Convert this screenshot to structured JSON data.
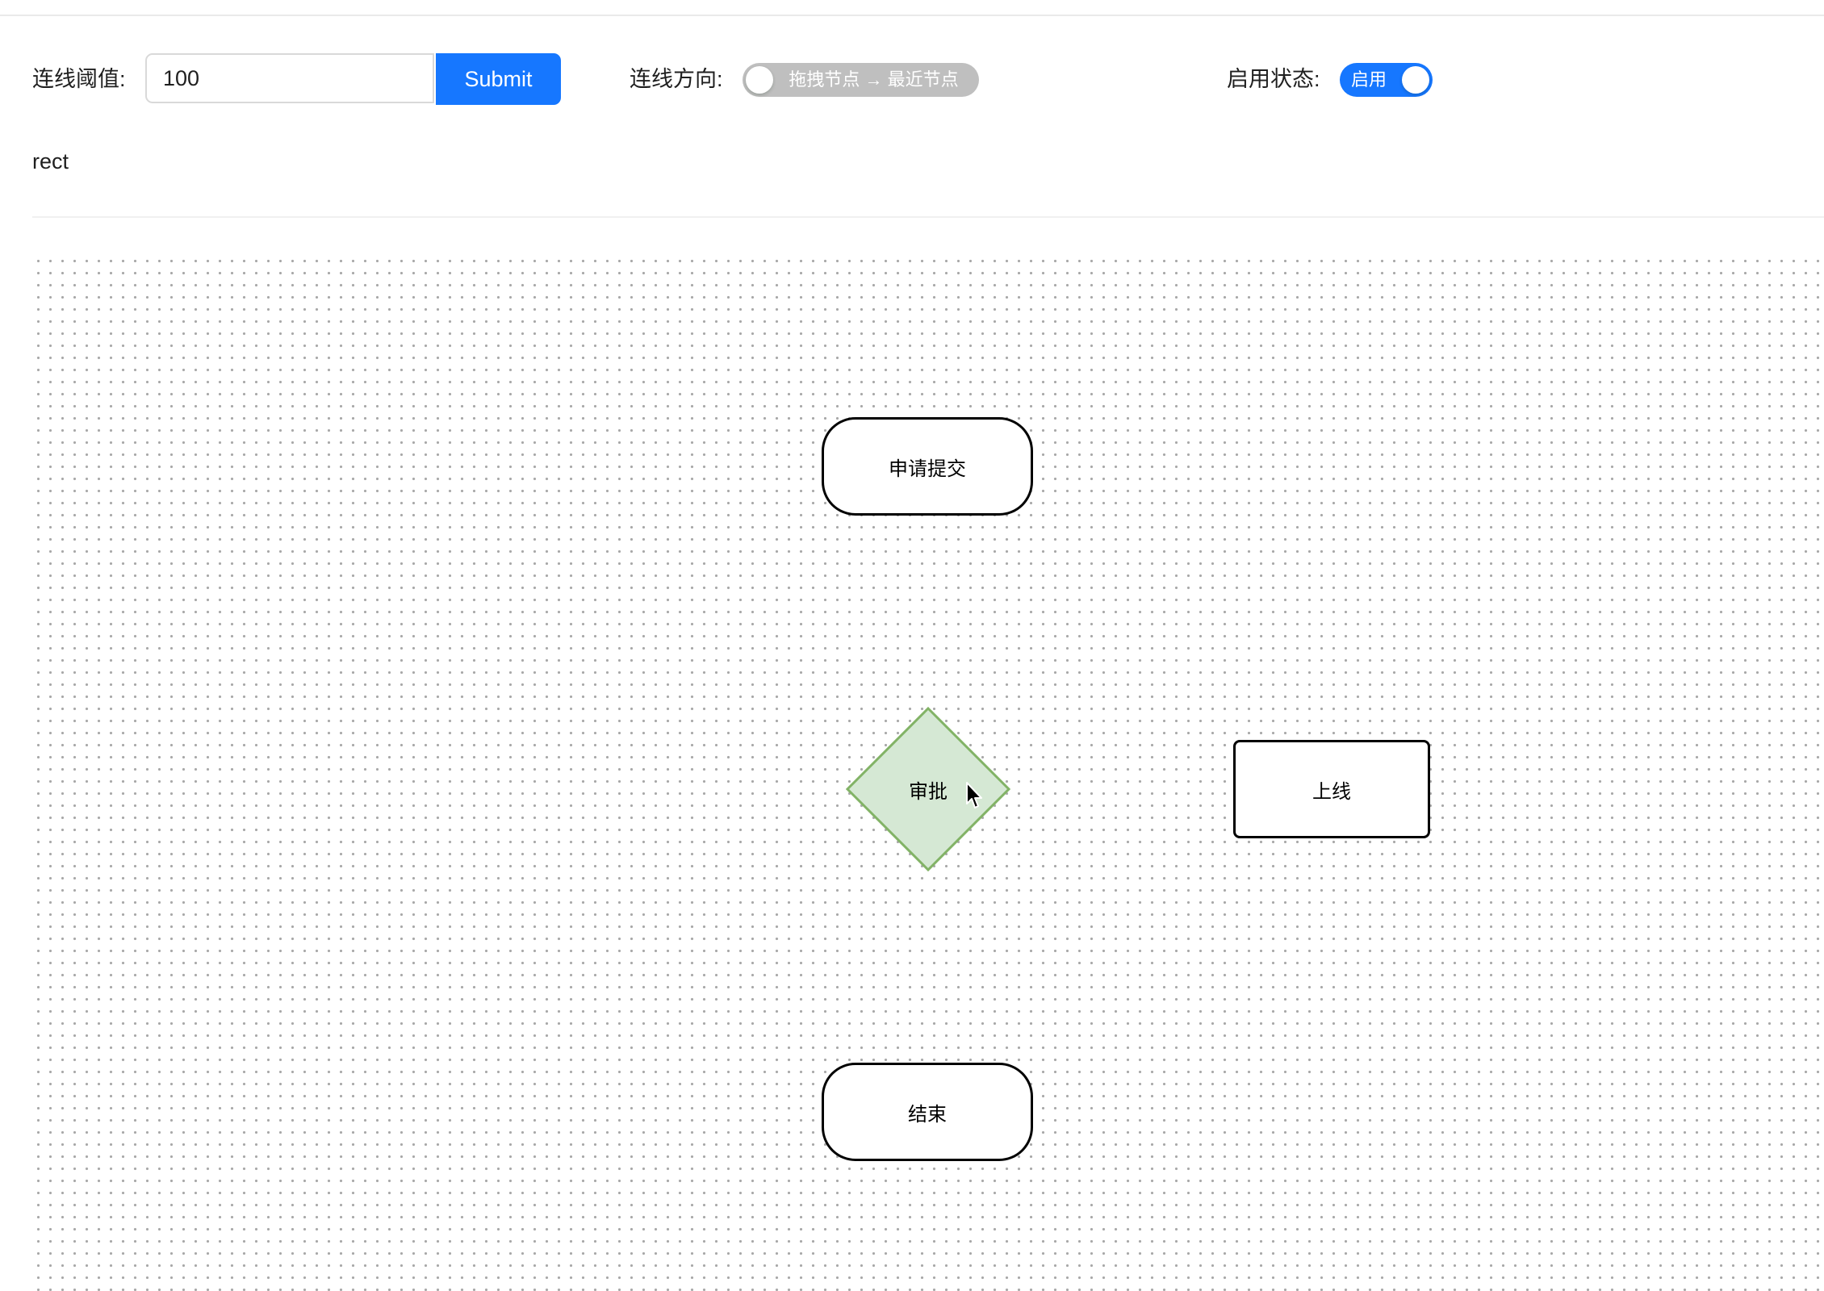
{
  "toolbar": {
    "threshold_label": "连线阈值:",
    "threshold_value": "100",
    "submit_label": "Submit",
    "direction_label": "连线方向:",
    "direction_switch_text": "拖拽节点 → 最近节点",
    "direction_switch_on": false,
    "enable_label": "启用状态:",
    "enable_switch_text": "启用",
    "enable_switch_on": true
  },
  "selected_shape": "rect",
  "canvas": {
    "grid": "dots",
    "nodes": {
      "start": {
        "label": "申请提交",
        "shape": "rounded-rect"
      },
      "approve": {
        "label": "审批",
        "shape": "diamond",
        "fill": "#d5e8d4",
        "stroke": "#82b366"
      },
      "online": {
        "label": "上线",
        "shape": "rect"
      },
      "end": {
        "label": "结束",
        "shape": "rounded-rect"
      }
    }
  },
  "colors": {
    "primary": "#1677ff",
    "switch_off": "#bfbfbf",
    "diamond_fill": "#d5e8d4",
    "diamond_stroke": "#82b366"
  }
}
